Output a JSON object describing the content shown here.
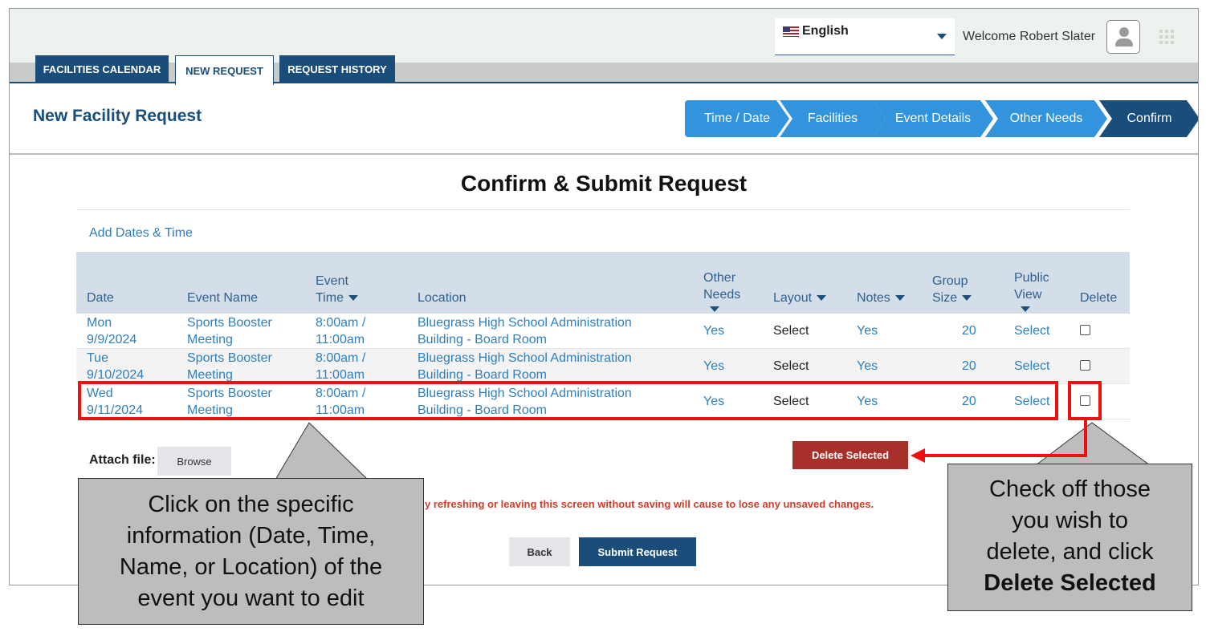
{
  "topbar": {
    "language": "English",
    "welcome": "Welcome Robert Slater"
  },
  "tabs": [
    {
      "label": "FACILITIES CALENDAR"
    },
    {
      "label": "NEW REQUEST"
    },
    {
      "label": "REQUEST HISTORY"
    }
  ],
  "page": {
    "title": "New Facility Request",
    "confirm_title": "Confirm & Submit Request",
    "add_dates": "Add Dates & Time"
  },
  "steps": [
    {
      "label": "Time / Date"
    },
    {
      "label": "Facilities"
    },
    {
      "label": "Event Details"
    },
    {
      "label": "Other Needs"
    },
    {
      "label": "Confirm"
    }
  ],
  "table": {
    "headers": {
      "date": "Date",
      "event_name": "Event Name",
      "event_time_1": "Event",
      "event_time_2": "Time",
      "location": "Location",
      "other_needs_1": "Other",
      "other_needs_2": "Needs",
      "layout": "Layout",
      "notes": "Notes",
      "group_size_1": "Group",
      "group_size_2": "Size",
      "public_view_1": "Public",
      "public_view_2": "View",
      "delete": "Delete"
    },
    "rows": [
      {
        "day": "Mon",
        "date": "9/9/2024",
        "name_1": "Sports Booster",
        "name_2": "Meeting",
        "time_1": "8:00am /",
        "time_2": "11:00am",
        "loc_1": "Bluegrass High School Administration",
        "loc_2": "Building - Board Room",
        "other_needs": "Yes",
        "layout": "Select",
        "notes": "Yes",
        "group_size": "20",
        "public_view": "Select"
      },
      {
        "day": "Tue",
        "date": "9/10/2024",
        "name_1": "Sports Booster",
        "name_2": "Meeting",
        "time_1": "8:00am /",
        "time_2": "11:00am",
        "loc_1": "Bluegrass High School Administration",
        "loc_2": "Building - Board Room",
        "other_needs": "Yes",
        "layout": "Select",
        "notes": "Yes",
        "group_size": "20",
        "public_view": "Select"
      },
      {
        "day": "Wed",
        "date": "9/11/2024",
        "name_1": "Sports Booster",
        "name_2": "Meeting",
        "time_1": "8:00am /",
        "time_2": "11:00am",
        "loc_1": "Bluegrass High School Administration",
        "loc_2": "Building - Board Room",
        "other_needs": "Yes",
        "layout": "Select",
        "notes": "Yes",
        "group_size": "20",
        "public_view": "Select"
      }
    ]
  },
  "attach": {
    "label": "Attach file:",
    "browse": "Browse"
  },
  "buttons": {
    "delete_selected": "Delete Selected",
    "back": "Back",
    "submit": "Submit Request"
  },
  "warning": "y refreshing or leaving this screen without saving will cause to lose any unsaved changes.",
  "callouts": {
    "left": [
      "Click on the specific",
      "information (Date, Time,",
      "Name, or Location) of the",
      "event you want to edit"
    ],
    "right_1": "Check off those",
    "right_2": "you wish to",
    "right_3": "delete, and click",
    "right_4": "Delete Selected"
  },
  "colors": {
    "primary": "#1b4d7a",
    "step": "#3194dc",
    "link": "#2d7fc1",
    "danger": "#a7312a",
    "highlight": "#ee1111"
  }
}
